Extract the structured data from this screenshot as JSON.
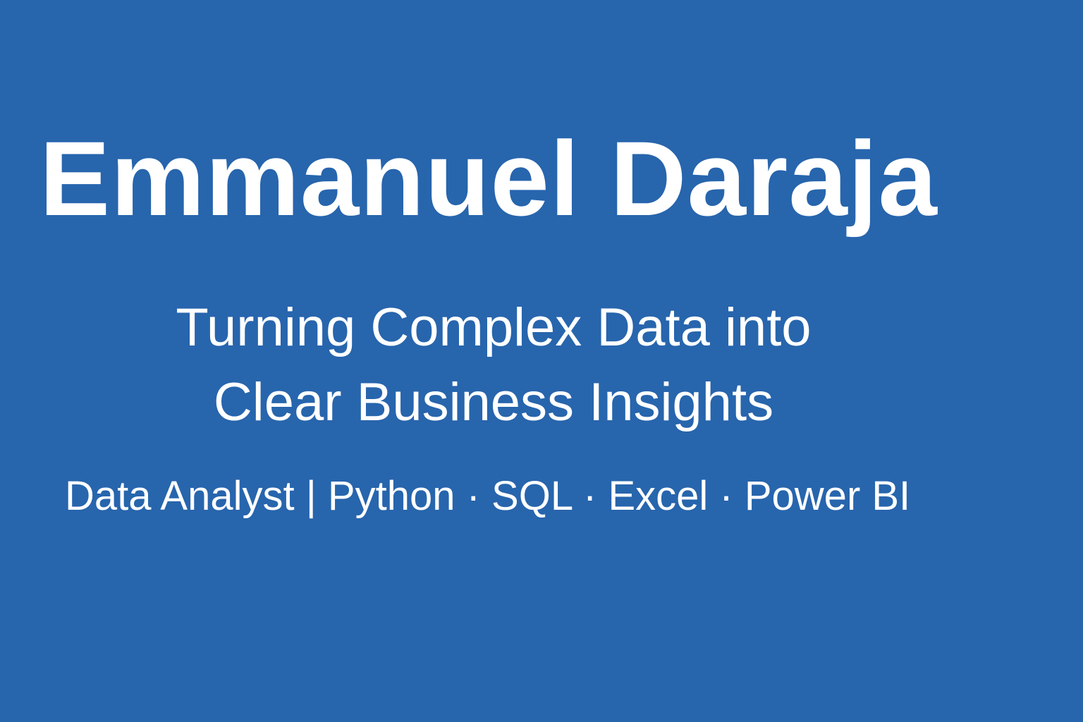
{
  "colors": {
    "background": "#2765ad",
    "text": "#ffffff"
  },
  "header": {
    "name": "Emmanuel Daraja"
  },
  "tagline": {
    "line1": "Turning Complex Data into",
    "line2": "Clear Business Insights"
  },
  "subtitle": {
    "text": "Data Analyst | Python · SQL · Excel · Power BI"
  }
}
